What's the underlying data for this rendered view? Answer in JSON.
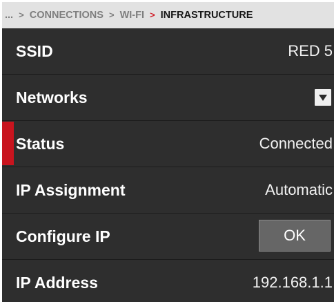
{
  "breadcrumb": {
    "ellipsis": "...",
    "separator": ">",
    "items": [
      "CONNECTIONS",
      "WI-FI"
    ],
    "current": "INFRASTRUCTURE"
  },
  "rows": {
    "ssid": {
      "label": "SSID",
      "value": "RED 5"
    },
    "networks": {
      "label": "Networks",
      "control_icon": "chevron-down-icon"
    },
    "status": {
      "label": "Status",
      "value": "Connected"
    },
    "ip_assignment": {
      "label": "IP Assignment",
      "value": "Automatic"
    },
    "configure_ip": {
      "label": "Configure IP",
      "button_label": "OK"
    },
    "ip_address": {
      "label": "IP Address",
      "value": "192.168.1.1"
    }
  },
  "colors": {
    "background": "#2e2e2e",
    "breadcrumb_background": "#e2e2e2",
    "accent_red": "#c8141e",
    "button": "#666666"
  }
}
